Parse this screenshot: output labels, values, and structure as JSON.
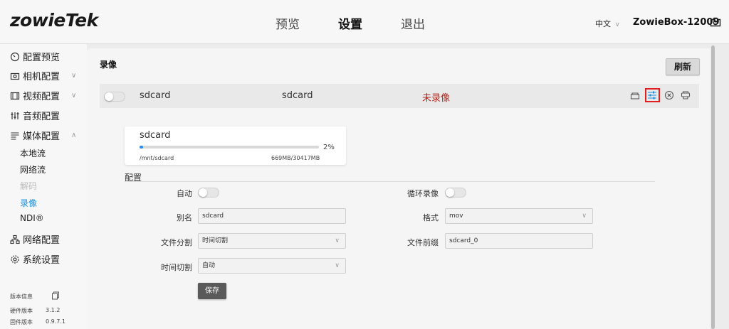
{
  "header": {
    "logo": "zowieTek",
    "nav": [
      {
        "label": "预览"
      },
      {
        "label": "设置"
      },
      {
        "label": "退出"
      }
    ],
    "language": "中文",
    "device_name": "ZowieBox-12009"
  },
  "sidebar": {
    "items": [
      {
        "label": "配置预览"
      },
      {
        "label": "相机配置"
      },
      {
        "label": "视频配置"
      },
      {
        "label": "音频配置"
      },
      {
        "label": "媒体配置"
      },
      {
        "label": "网络配置"
      },
      {
        "label": "系统设置"
      }
    ],
    "media_sub": [
      {
        "label": "本地流"
      },
      {
        "label": "网络流"
      },
      {
        "label": "解码"
      },
      {
        "label": "录像"
      },
      {
        "label": "NDI®"
      }
    ],
    "version": {
      "title": "版本信息",
      "hw_label": "硬件版本",
      "hw_value": "3.1.2",
      "fw_label": "固件版本",
      "fw_value": "0.9.7.1"
    }
  },
  "main": {
    "section_title": "录像",
    "refresh_label": "刷新",
    "device_row": {
      "name": "sdcard",
      "alias": "sdcard",
      "status": "未录像"
    },
    "storage": {
      "name": "sdcard",
      "percent_label": "2%",
      "percent": 2,
      "path": "/mnt/sdcard",
      "size": "669MB/30417MB"
    },
    "config": {
      "title": "配置",
      "auto_label": "自动",
      "loop_label": "循环录像",
      "alias_label": "别名",
      "alias_value": "sdcard",
      "format_label": "格式",
      "format_value": "mov",
      "split_label": "文件分割",
      "split_value": "时间切割",
      "prefix_label": "文件前缀",
      "prefix_value": "sdcard_0",
      "time_split_label": "时间切割",
      "time_split_value": "自动",
      "save_label": "保存"
    }
  },
  "colors": {
    "accent": "#1a8fe0",
    "status_red": "#b3261e",
    "highlight_frame": "#e02020",
    "progress": "#2d8cf0"
  }
}
